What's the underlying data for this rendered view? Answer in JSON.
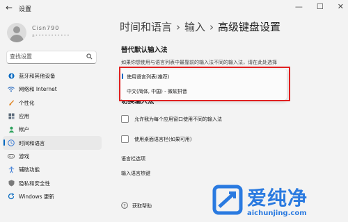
{
  "titlebar": {
    "back_glyph": "←",
    "app_title": "设置",
    "minimize_glyph": "—",
    "maximize_glyph": "☐",
    "close_glyph": "✕"
  },
  "user": {
    "name": "Cisn790",
    "email": "a•••••••••••"
  },
  "search": {
    "value": "查找设置",
    "icon": "search-icon"
  },
  "sidebar": {
    "items": [
      {
        "label": "蓝牙和其他设备",
        "icon": "bluetooth-icon",
        "color": "#0067c0",
        "active": false
      },
      {
        "label": "网络和 Internet",
        "icon": "wifi-icon",
        "color": "#2d6dbf",
        "active": false
      },
      {
        "label": "个性化",
        "icon": "brush-icon",
        "color": "#e08a2c",
        "active": false
      },
      {
        "label": "应用",
        "icon": "apps-icon",
        "color": "#5d6b7a",
        "active": false
      },
      {
        "label": "帐户",
        "icon": "account-icon",
        "color": "#2aa05a",
        "active": false
      },
      {
        "label": "时间和语言",
        "icon": "globe-clock-icon",
        "color": "#3a7bd5",
        "active": true
      },
      {
        "label": "游戏",
        "icon": "gamepad-icon",
        "color": "#6a6a6a",
        "active": false
      },
      {
        "label": "辅助功能",
        "icon": "accessibility-icon",
        "color": "#3a7bd5",
        "active": false
      },
      {
        "label": "隐私和安全性",
        "icon": "shield-icon",
        "color": "#6a6a6a",
        "active": false
      },
      {
        "label": "Windows 更新",
        "icon": "update-icon",
        "color": "#0067c0",
        "active": false
      }
    ]
  },
  "breadcrumb": {
    "part1": "时间和语言",
    "part2": "输入",
    "part3": "高级键盘设置",
    "separator": "›"
  },
  "override": {
    "title": "替代默认输入法",
    "description": "如果你想使用与语言列表中最靠前的输入法不同的输入法，请在此处选择",
    "options": [
      "使用语言列表(推荐)",
      "中文(简体, 中国) - 微软拼音"
    ],
    "selected_index": 0
  },
  "switch": {
    "title": "切换输入法",
    "checkbox1_label": "允许我为每个应用窗口使用不同的输入法",
    "checkbox1_checked": false,
    "checkbox2_label": "使用桌面语言栏(如果可用)",
    "checkbox2_checked": false
  },
  "links": {
    "language_bar": "语言栏选项",
    "hotkeys": "输入语言热键"
  },
  "help": {
    "label": "获取帮助"
  },
  "watermark": {
    "cn": "爱纯净",
    "url": "aichunjing.com"
  },
  "colors": {
    "accent": "#0067c0",
    "highlight_border": "#e02020",
    "watermark": "#2a7ae0"
  }
}
